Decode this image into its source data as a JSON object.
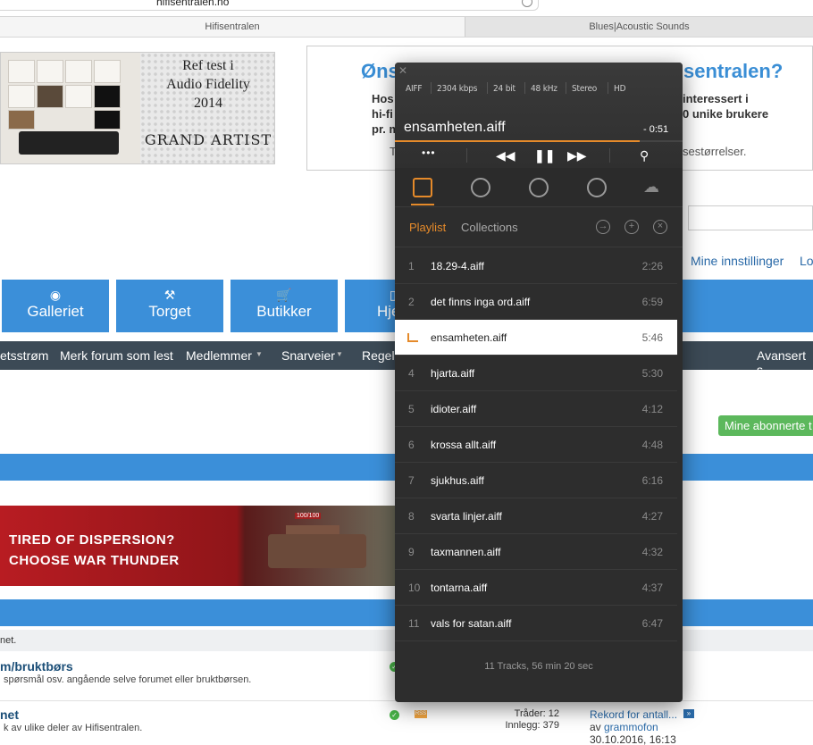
{
  "browser": {
    "url": "hifisentralen.no",
    "tabs": [
      "Hifisentralen",
      "Blues|Acoustic Sounds"
    ]
  },
  "ad_left": {
    "line1": "Ref test i",
    "line2": "Audio Fidelity",
    "line3": "2014",
    "brand": "GRAND ARTIST"
  },
  "ad_right": {
    "heading_start": "Øns",
    "heading_end": "sentralen?",
    "line1_start": "Hos",
    "line1_end": "interessert i",
    "line2_start": "hi-fi",
    "line2_end": "0 unike brukere",
    "line3_start": "pr. m",
    "line4_start": "T",
    "line4_end": "sestørrelser."
  },
  "top_links": [
    "Mine innstillinger",
    "Lo"
  ],
  "nav_buttons": [
    "Galleriet",
    "Torget",
    "Butikker",
    "Hje"
  ],
  "subnav": {
    "items": [
      "etsstrøm",
      "Merk forum som lest",
      "Medlemmer",
      "Snarveier",
      "Regel"
    ],
    "right": "Avansert s"
  },
  "subscribed_button": "Mine abonnerte t",
  "war_thunder_ad": {
    "line1": "TIRED OF DISPERSION?",
    "line2": "CHOOSE WAR THUNDER",
    "hud": "100/100"
  },
  "forum": {
    "subheader": "net.",
    "rows": [
      {
        "title": "m/bruktbørs",
        "desc": "spørsmål osv. angående selve forumet eller bruktbørsen."
      },
      {
        "title": "net",
        "desc": "k av ulike deler av Hifisentralen.",
        "threads": "Tråder: 12",
        "posts": "Innlegg: 379",
        "last_title": "Rekord for antall...",
        "last_by_prefix": "av",
        "last_by": "grammofon",
        "last_date": "30.10.2016, 16:13"
      }
    ]
  },
  "player": {
    "format": [
      "AIFF",
      "2304 kbps",
      "24 bit",
      "48 kHz",
      "Stereo",
      "HD"
    ],
    "now_playing": "ensamheten.aiff",
    "remaining": "- 0:51",
    "progress": 0.85,
    "controls": {
      "more": "•••"
    },
    "tabs": {
      "playlist": "Playlist",
      "collections": "Collections"
    },
    "accent": "#e58a2a",
    "playlist": [
      {
        "num": "1",
        "title": "18.29-4.aiff",
        "dur": "2:26"
      },
      {
        "num": "2",
        "title": "det finns inga ord.aiff",
        "dur": "6:59"
      },
      {
        "num": "3",
        "title": "ensamheten.aiff",
        "dur": "5:46",
        "playing": true
      },
      {
        "num": "4",
        "title": "hjarta.aiff",
        "dur": "5:30"
      },
      {
        "num": "5",
        "title": "idioter.aiff",
        "dur": "4:12"
      },
      {
        "num": "6",
        "title": "krossa allt.aiff",
        "dur": "4:48"
      },
      {
        "num": "7",
        "title": "sjukhus.aiff",
        "dur": "6:16"
      },
      {
        "num": "8",
        "title": "svarta linjer.aiff",
        "dur": "4:27"
      },
      {
        "num": "9",
        "title": "taxmannen.aiff",
        "dur": "4:32"
      },
      {
        "num": "10",
        "title": "tontarna.aiff",
        "dur": "4:37"
      },
      {
        "num": "11",
        "title": "vals for satan.aiff",
        "dur": "6:47"
      }
    ],
    "summary": "11 Tracks, 56 min 20 sec"
  }
}
